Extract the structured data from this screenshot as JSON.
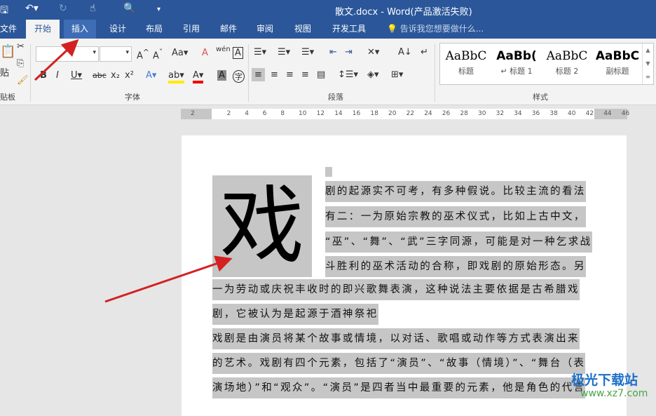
{
  "window": {
    "title": "散文.docx - Word(产品激活失败)"
  },
  "tabs": [
    {
      "label": "文件"
    },
    {
      "label": "开始"
    },
    {
      "label": "插入"
    },
    {
      "label": "设计"
    },
    {
      "label": "布局"
    },
    {
      "label": "引用"
    },
    {
      "label": "邮件"
    },
    {
      "label": "审阅"
    },
    {
      "label": "视图"
    },
    {
      "label": "开发工具"
    }
  ],
  "tell_me": "告诉我您想要做什么...",
  "ribbon": {
    "groups": {
      "clipboard": "贴板",
      "paste": "贴",
      "font": "字体",
      "paragraph": "段落",
      "styles": "样式"
    },
    "styles": [
      {
        "preview": "AaBbC",
        "label": "标题"
      },
      {
        "preview": "AaBb(",
        "label": "↵ 标题 1"
      },
      {
        "preview": "AaBbC",
        "label": "标题 2"
      },
      {
        "preview": "AaBbC",
        "label": "副标题"
      }
    ]
  },
  "ruler": [
    "2",
    "2",
    "4",
    "6",
    "8",
    "10",
    "12",
    "14",
    "16",
    "18",
    "20",
    "22",
    "24",
    "26",
    "28",
    "30",
    "32",
    "34",
    "36",
    "38",
    "40",
    "42",
    "44",
    "46"
  ],
  "document": {
    "drop_cap": "戏",
    "lines": [
      "剧的起源实不可考，有多种假说。比较主流的看法",
      "有二：一为原始宗教的巫术仪式，比如上古中文，",
      "“巫”、“舞”、“武”三字同源，可能是对一种乞求战",
      "斗胜利的巫术活动的合称，即戏剧的原始形态。另",
      "一为劳动或庆祝丰收时的即兴歌舞表演，这种说法主要依据是古希腊戏",
      "剧，它被认为是起源于酒神祭祀",
      "戏剧是由演员将某个故事或情境，以对话、歌唱或动作等方式表演出来",
      "的艺术。戏剧有四个元素，包括了“演员”、“故事（情境）”、“舞台（表",
      "演场地）”和“观众”。“演员”是四者当中最重要的元素，他是角色的代言"
    ]
  },
  "watermark": {
    "name": "极光下载站",
    "url": "www.xz7.com"
  },
  "colors": {
    "title_bar": "#2b579a",
    "highlight": "#c6c6c6",
    "arrow": "#d42020"
  }
}
